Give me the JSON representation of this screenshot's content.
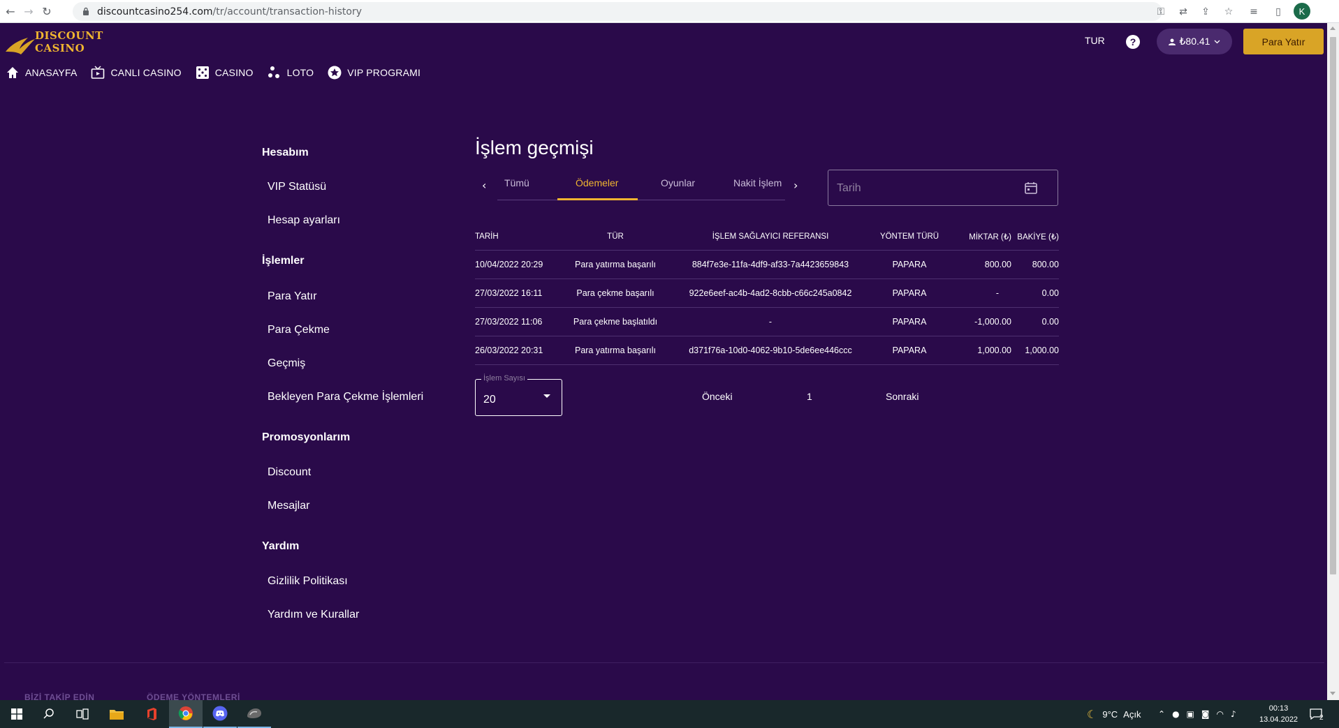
{
  "browser": {
    "url_host": "discountcasino254.com",
    "url_path": "/tr/account/transaction-history",
    "profile_initial": "K"
  },
  "header": {
    "logo_line1": "DISCOUNT",
    "logo_line2": "CASINO",
    "language": "TUR",
    "help": "?",
    "balance": "₺80.41",
    "deposit_label": "Para Yatır"
  },
  "mainnav": [
    {
      "label": "ANASAYFA",
      "icon": "home-icon"
    },
    {
      "label": "CANLI CASINO",
      "icon": "tv-icon"
    },
    {
      "label": "CASINO",
      "icon": "dice-icon"
    },
    {
      "label": "LOTO",
      "icon": "balls-icon"
    },
    {
      "label": "VIP PROGRAMI",
      "icon": "star-icon"
    }
  ],
  "sidebar": {
    "sections": [
      {
        "title": "Hesabım",
        "items": [
          "VIP Statüsü",
          "Hesap ayarları"
        ]
      },
      {
        "title": "İşlemler",
        "items": [
          "Para Yatır",
          "Para Çekme",
          "Geçmiş",
          "Bekleyen Para Çekme İşlemleri"
        ]
      },
      {
        "title": "Promosyonlarım",
        "items": [
          "Discount",
          "Mesajlar"
        ]
      },
      {
        "title": "Yardım",
        "items": [
          "Gizlilik Politikası",
          "Yardım ve Kurallar"
        ]
      }
    ]
  },
  "main": {
    "title": "İşlem geçmişi",
    "tabs": [
      "Tümü",
      "Ödemeler",
      "Oyunlar",
      "Nakit İşlem"
    ],
    "active_tab": "Ödemeler",
    "date_placeholder": "Tarih",
    "columns": [
      "TARİH",
      "TÜR",
      "İŞLEM SAĞLAYICI REFERANSI",
      "YÖNTEM TÜRÜ",
      "MİKTAR (₺)",
      "BAKİYE (₺)"
    ],
    "rows": [
      [
        "10/04/2022 20:29",
        "Para yatırma başarılı",
        "884f7e3e-11fa-4df9-af33-7a4423659843",
        "PAPARA",
        "800.00",
        "800.00"
      ],
      [
        "27/03/2022 16:11",
        "Para çekme başarılı",
        "922e6eef-ac4b-4ad2-8cbb-c66c245a0842",
        "PAPARA",
        "-",
        "0.00"
      ],
      [
        "27/03/2022 11:06",
        "Para çekme başlatıldı",
        "-",
        "PAPARA",
        "-1,000.00",
        "0.00"
      ],
      [
        "26/03/2022 20:31",
        "Para yatırma başarılı",
        "d371f76a-10d0-4062-9b10-5de6ee446ccc",
        "PAPARA",
        "1,000.00",
        "1,000.00"
      ]
    ],
    "count_label": "İşlem Sayısı",
    "count_value": "20",
    "prev_label": "Önceki",
    "page_number": "1",
    "next_label": "Sonraki"
  },
  "footer": {
    "follow": "BİZİ TAKİP EDİN",
    "payments": "ÖDEME YÖNTEMLERİ"
  },
  "taskbar": {
    "weather_temp": "9°C",
    "weather_text": "Açık",
    "time": "00:13",
    "date": "13.04.2022",
    "notifications": "2"
  }
}
